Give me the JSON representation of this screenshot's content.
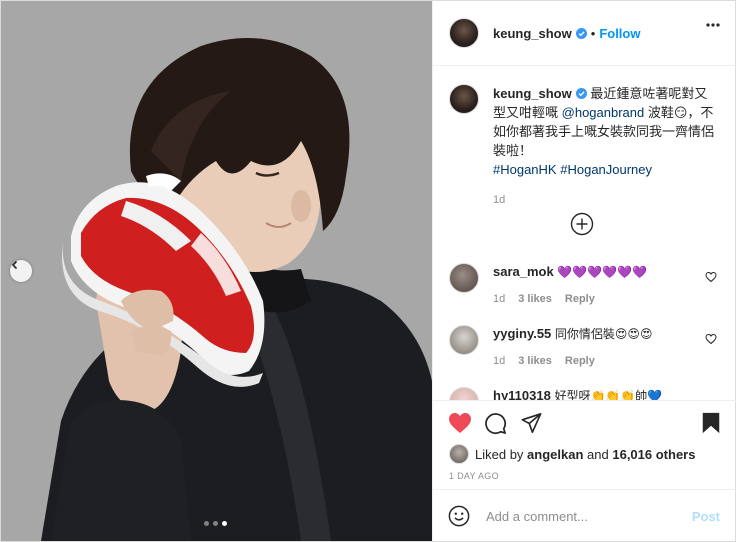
{
  "post": {
    "username": "keung_show",
    "follow_label": "Follow",
    "separator": "•",
    "caption": {
      "text_line1": "最近鍾意咗著呢對又型又咁輕嘅",
      "mention": "@hoganbrand",
      "text_line2": " 波鞋😏，不如你都著我手上嘅女裝款同我一齊情侶裝啦！",
      "hashtags": [
        "#HoganHK",
        "#HoganJourney"
      ],
      "age": "1d"
    },
    "comments": [
      {
        "username": "sara_mok",
        "text": "💜💜💜💜💜💜",
        "age": "1d",
        "likes": "3 likes",
        "reply": "Reply"
      },
      {
        "username": "yyginy.55",
        "text": "同你情侶裝😍😍😍",
        "age": "1d",
        "likes": "3 likes",
        "reply": "Reply"
      },
      {
        "username": "hy110318",
        "text": "好型呀👏👏👏帥💙",
        "age": "",
        "likes": "",
        "reply": ""
      }
    ],
    "liked_by": {
      "prefix": "Liked by",
      "user": "angelkan",
      "middle": "and",
      "others": "16,016 others"
    },
    "time_ago": "1 DAY AGO",
    "add_comment_placeholder": "Add a comment...",
    "post_label": "Post"
  },
  "carousel": {
    "count": 3,
    "active": 3
  },
  "colors": {
    "verified": "#3897f0",
    "like_red": "#ed4956",
    "follow_blue": "#0095f6"
  }
}
